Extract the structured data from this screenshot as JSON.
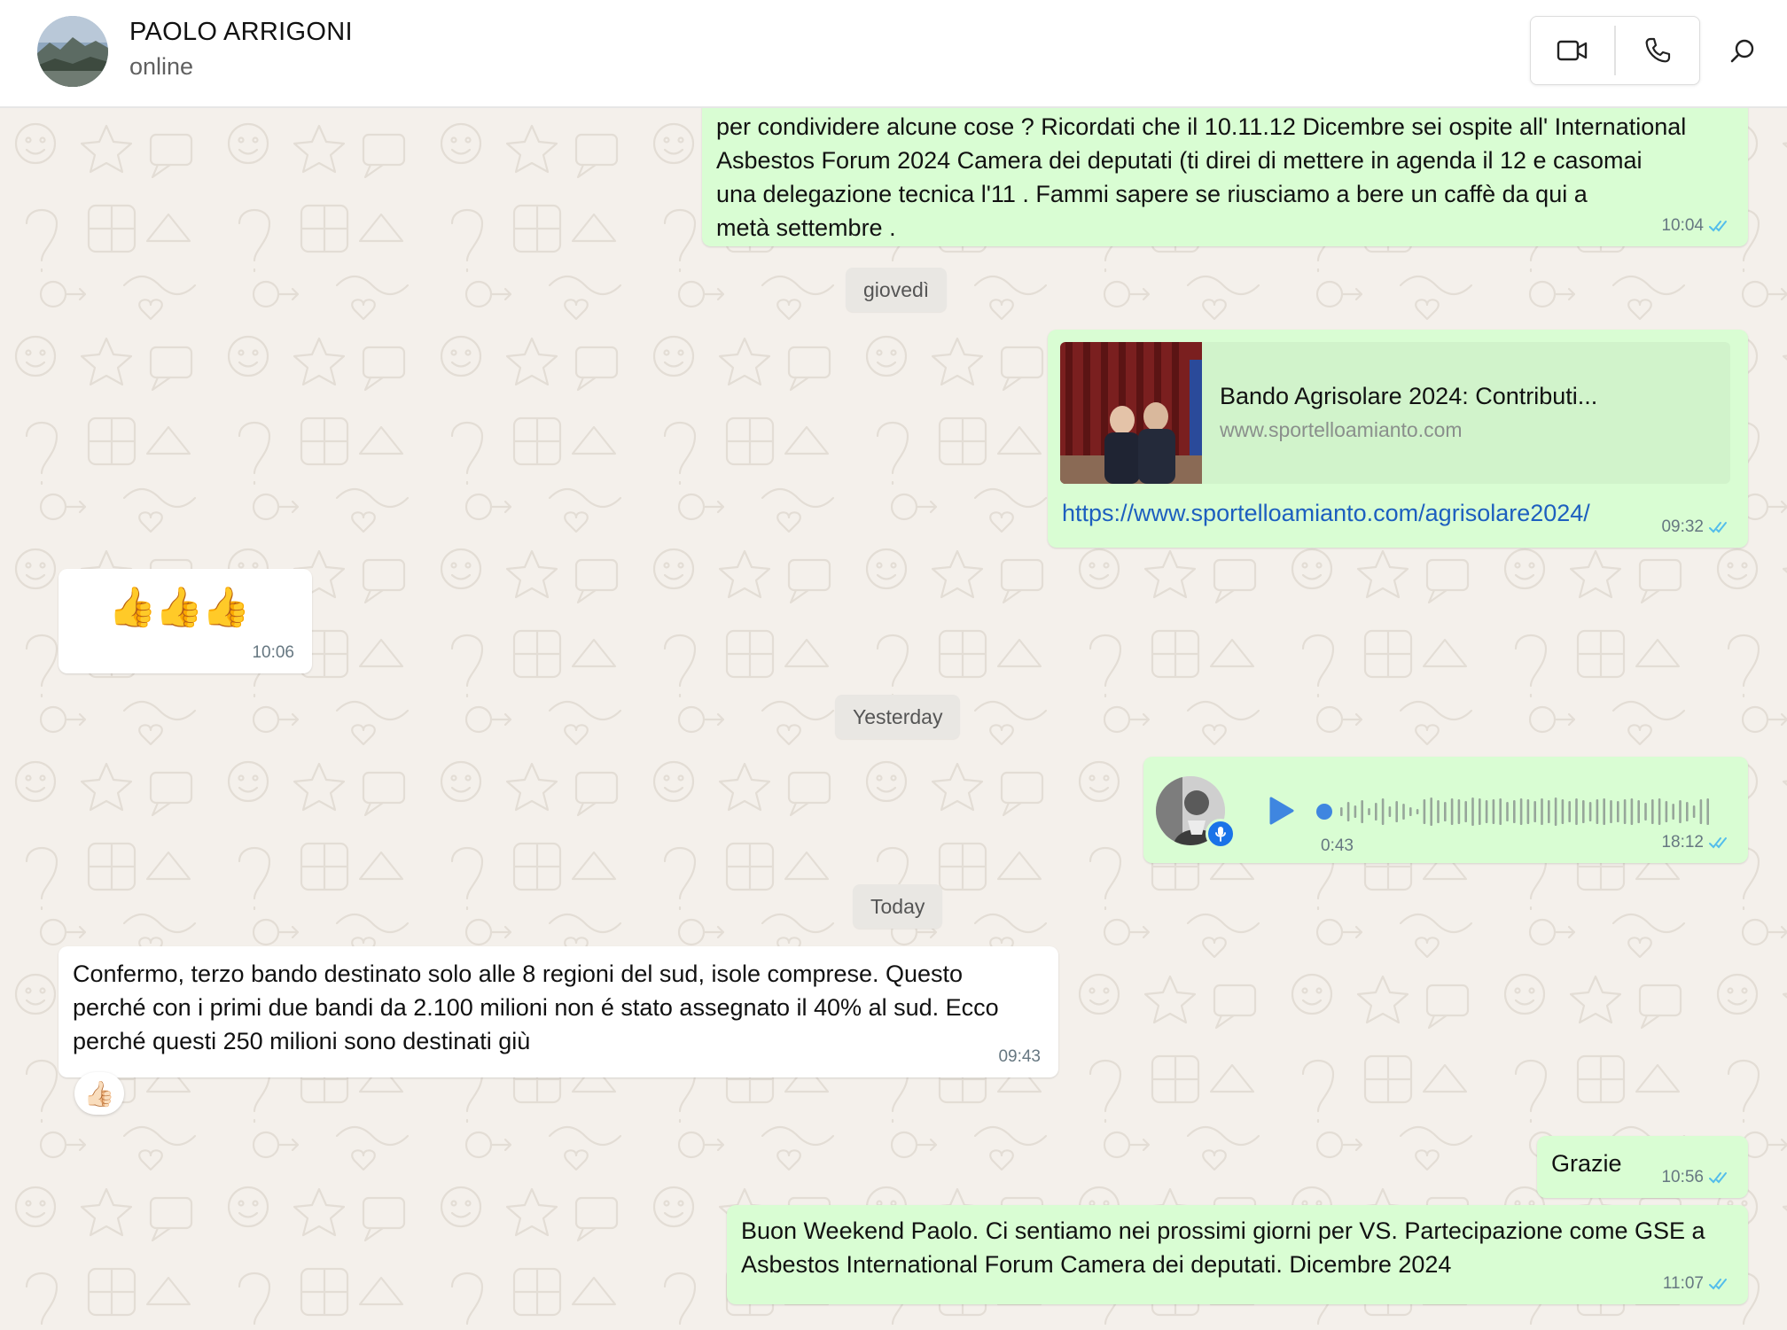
{
  "header": {
    "contact_name": "PAOLO ARRIGONI",
    "contact_status": "online",
    "icons": [
      "video-call-icon",
      "voice-call-icon",
      "search-icon"
    ]
  },
  "messages": {
    "m1": {
      "text": "per condividere alcune cose ? Ricordati che il 10.11.12 Dicembre sei ospite all' International\nAsbestos Forum 2024 Camera dei deputati (ti direi di mettere in agenda il 12 e casomai\nuna delegazione tecnica l'11 . Fammi sapere se riusciamo a bere un caffè da qui a\nmetà settembre .",
      "time": "10:04"
    },
    "date1": "giovedì",
    "m2": {
      "preview_title": "Bando Agrisolare 2024: Contributi...",
      "preview_domain": "www.sportelloamianto.com",
      "link": "https://www.sportelloamianto.com/agrisolare2024/",
      "time": "09:32"
    },
    "m3": {
      "emoji": "👍👍👍",
      "time": "10:06"
    },
    "date2": "Yesterday",
    "m4": {
      "duration": "0:43",
      "time": "18:12"
    },
    "date3": "Today",
    "m5": {
      "text": "Confermo, terzo bando destinato solo alle 8 regioni del sud, isole comprese. Questo\nperché con i primi due bandi da 2.100 milioni non é stato assegnato il 40% al sud. Ecco\nperché questi 250 milioni sono destinati giù",
      "time": "09:43",
      "reaction": "👍🏻"
    },
    "m6": {
      "text": "Grazie",
      "time": "10:56"
    },
    "m7": {
      "text": "Buon Weekend Paolo. Ci sentiamo nei prossimi giorni per VS. Partecipazione come GSE a\nAsbestos International Forum Camera dei deputati. Dicembre 2024",
      "time": "11:07"
    }
  },
  "colors": {
    "outgoing_bubble": "#d9fdd3",
    "incoming_bubble": "#ffffff",
    "read_ticks": "#53bdeb",
    "link": "#1d5fbf",
    "play_button": "#3f86e0",
    "background": "#f4f0eb"
  }
}
